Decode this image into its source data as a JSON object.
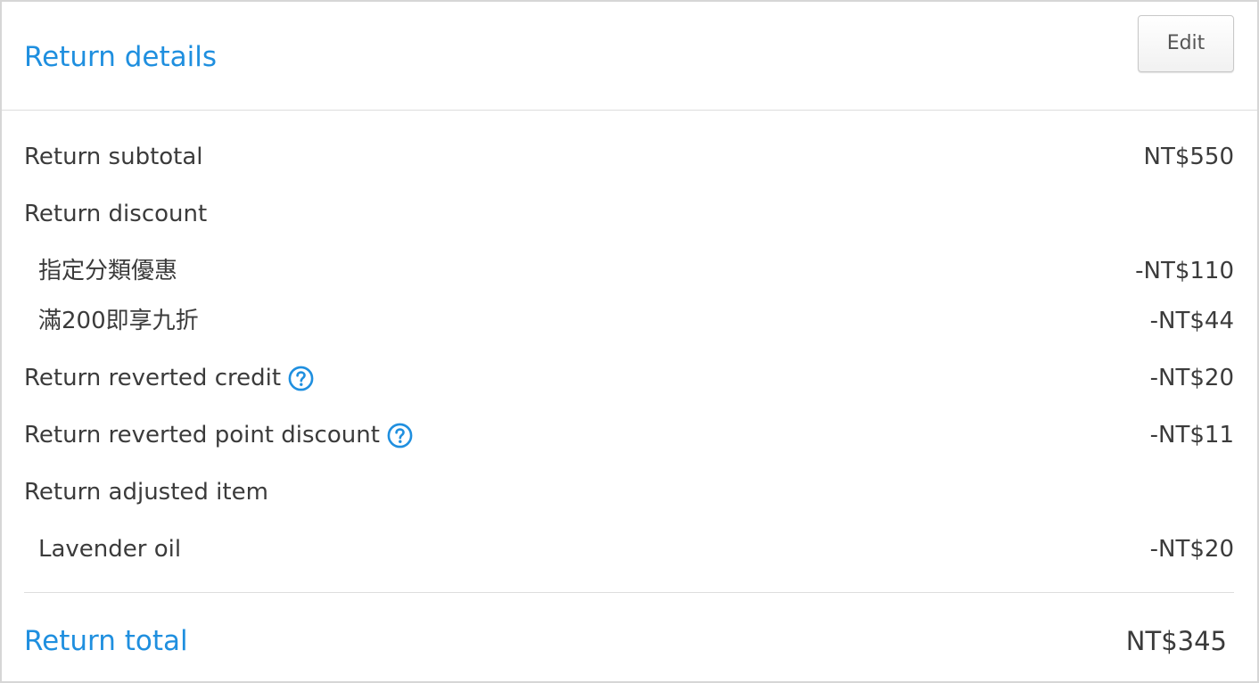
{
  "header": {
    "title": "Return details",
    "edit_label": "Edit"
  },
  "rows": [
    {
      "label": "Return subtotal",
      "value": "NT$550"
    },
    {
      "label": "Return discount",
      "value": ""
    },
    {
      "label": "指定分類優惠",
      "value": "-NT$110"
    },
    {
      "label": "滿200即享九折",
      "value": "-NT$44"
    },
    {
      "label": "Return reverted credit",
      "value": "-NT$20"
    },
    {
      "label": "Return reverted point discount",
      "value": "-NT$11"
    },
    {
      "label": "Return adjusted item",
      "value": ""
    },
    {
      "label": "Lavender oil",
      "value": "-NT$20"
    }
  ],
  "footer": {
    "total_label": "Return total",
    "total_value": "NT$345"
  },
  "icons": {
    "help": "question-circle-icon"
  },
  "colors": {
    "accent": "#1f8fdf",
    "text": "#3b3b3b",
    "border": "#d6d6d6"
  }
}
